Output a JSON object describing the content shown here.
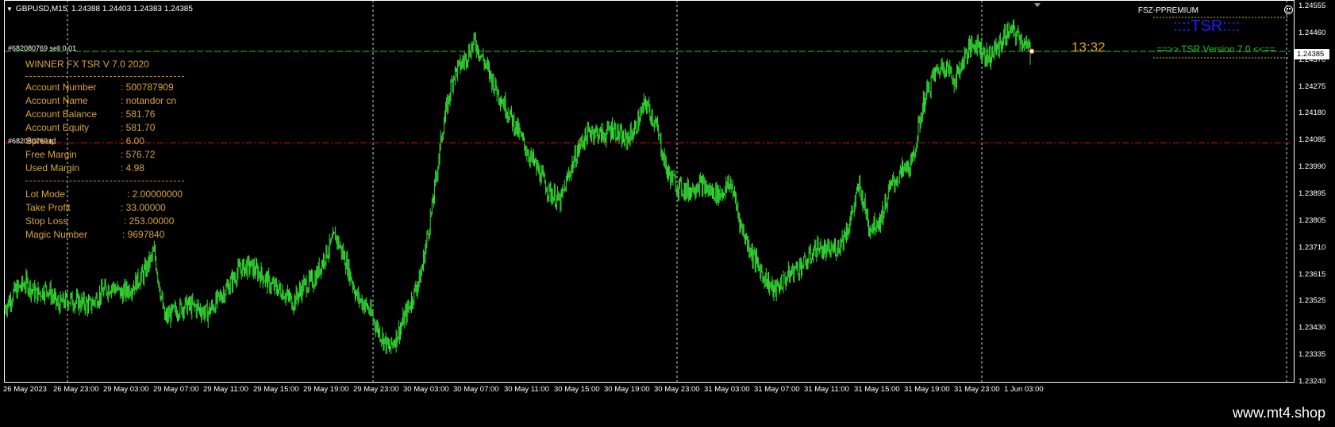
{
  "header": {
    "symbol": "GBPUSD,M15",
    "ohlc": "1.24388 1.24403 1.24383 1.24385"
  },
  "indicator_label": "FSZ-PPREMIUM",
  "tsr": {
    "title": "::::TSR::::",
    "version": "==>> TSR Version 7.0 <<=="
  },
  "countdown": "13:32",
  "orders": {
    "sell": "#682080769 sell 0.01",
    "tp": "#682080769 tp"
  },
  "panel": {
    "title": "WINNER FX TSR V 7.0  2020",
    "separator": "-------------------------------------------------",
    "account": [
      {
        "label": "Account Number",
        "value": ": 500787909"
      },
      {
        "label": "Account Name",
        "value": ": notandor cn"
      },
      {
        "label": "Account Balance",
        "value": ": 581.76"
      },
      {
        "label": "Account Equity",
        "value": ": 581.70"
      },
      {
        "label": "Spread",
        "value": ": 6.00"
      },
      {
        "label": "Free Margin",
        "value": ": 576.72"
      },
      {
        "label": "Used Margin",
        "value": ": 4.98"
      }
    ],
    "settings": [
      {
        "label": "Lot Mode",
        "value": ": 2.00000000"
      },
      {
        "label": "Take Profit",
        "value": ": 33.00000"
      },
      {
        "label": "Stop Loss",
        "value": ": 253.00000"
      },
      {
        "label": "Magic Number",
        "value": ": 9697840"
      }
    ]
  },
  "price_axis": {
    "ticks": [
      "1.24555",
      "1.24460",
      "1.24370",
      "1.24275",
      "1.24180",
      "1.24085",
      "1.23990",
      "1.23895",
      "1.23805",
      "1.23710",
      "1.23615",
      "1.23525",
      "1.23430",
      "1.23335",
      "1.23240"
    ],
    "current_price": "1.24385"
  },
  "time_axis": {
    "ticks": [
      "26 May 2023",
      "26 May 23:00",
      "29 May 03:00",
      "29 May 07:00",
      "29 May 11:00",
      "29 May 15:00",
      "29 May 19:00",
      "29 May 23:00",
      "30 May 03:00",
      "30 May 07:00",
      "30 May 11:00",
      "30 May 15:00",
      "30 May 19:00",
      "30 May 23:00",
      "31 May 03:00",
      "31 May 07:00",
      "31 May 11:00",
      "31 May 15:00",
      "31 May 19:00",
      "31 May 23:00",
      "1 Jun 03:00"
    ]
  },
  "chart_data": {
    "type": "candlestick",
    "symbol": "GBPUSD",
    "timeframe": "M15",
    "ylim": [
      1.2319,
      1.2457
    ],
    "order_sell_level": 1.24385,
    "order_tp_level": 1.24055,
    "close_path": [
      [
        0,
        1.2346
      ],
      [
        12,
        1.2352
      ],
      [
        25,
        1.2355
      ],
      [
        37,
        1.2351
      ],
      [
        50,
        1.2353
      ],
      [
        62,
        1.2347
      ],
      [
        75,
        1.2349
      ],
      [
        87,
        1.2348
      ],
      [
        100,
        1.2347
      ],
      [
        112,
        1.2351
      ],
      [
        125,
        1.2354
      ],
      [
        137,
        1.2351
      ],
      [
        150,
        1.2354
      ],
      [
        162,
        1.2358
      ],
      [
        175,
        1.2366
      ],
      [
        187,
        1.2342
      ],
      [
        200,
        1.2345
      ],
      [
        212,
        1.2347
      ],
      [
        225,
        1.2346
      ],
      [
        237,
        1.2344
      ],
      [
        250,
        1.2349
      ],
      [
        262,
        1.2354
      ],
      [
        275,
        1.236
      ],
      [
        287,
        1.2361
      ],
      [
        300,
        1.2358
      ],
      [
        312,
        1.2354
      ],
      [
        325,
        1.2352
      ],
      [
        337,
        1.2348
      ],
      [
        350,
        1.2354
      ],
      [
        362,
        1.2356
      ],
      [
        375,
        1.2365
      ],
      [
        387,
        1.2372
      ],
      [
        400,
        1.2362
      ],
      [
        412,
        1.235
      ],
      [
        425,
        1.2346
      ],
      [
        437,
        1.2338
      ],
      [
        450,
        1.2331
      ],
      [
        462,
        1.2338
      ],
      [
        475,
        1.2348
      ],
      [
        487,
        1.2358
      ],
      [
        500,
        1.2382
      ],
      [
        512,
        1.241
      ],
      [
        525,
        1.243
      ],
      [
        537,
        1.2435
      ],
      [
        550,
        1.2442
      ],
      [
        562,
        1.2434
      ],
      [
        575,
        1.2425
      ],
      [
        587,
        1.2418
      ],
      [
        600,
        1.241
      ],
      [
        612,
        1.2402
      ],
      [
        625,
        1.2395
      ],
      [
        637,
        1.2388
      ],
      [
        650,
        1.2384
      ],
      [
        662,
        1.2396
      ],
      [
        675,
        1.2406
      ],
      [
        687,
        1.241
      ],
      [
        700,
        1.2408
      ],
      [
        712,
        1.2411
      ],
      [
        725,
        1.2406
      ],
      [
        737,
        1.241
      ],
      [
        750,
        1.242
      ],
      [
        762,
        1.2412
      ],
      [
        775,
        1.2395
      ],
      [
        787,
        1.239
      ],
      [
        800,
        1.2388
      ],
      [
        812,
        1.2391
      ],
      [
        825,
        1.2388
      ],
      [
        837,
        1.2387
      ],
      [
        850,
        1.2391
      ],
      [
        862,
        1.2375
      ],
      [
        875,
        1.2365
      ],
      [
        887,
        1.2358
      ],
      [
        900,
        1.2352
      ],
      [
        912,
        1.2356
      ],
      [
        925,
        1.236
      ],
      [
        937,
        1.2362
      ],
      [
        950,
        1.2368
      ],
      [
        962,
        1.2366
      ],
      [
        975,
        1.2368
      ],
      [
        987,
        1.2375
      ],
      [
        1000,
        1.239
      ],
      [
        1012,
        1.2375
      ],
      [
        1025,
        1.2378
      ],
      [
        1037,
        1.239
      ],
      [
        1050,
        1.2395
      ],
      [
        1062,
        1.2398
      ],
      [
        1075,
        1.242
      ],
      [
        1087,
        1.243
      ],
      [
        1100,
        1.2434
      ],
      [
        1112,
        1.2428
      ],
      [
        1125,
        1.2438
      ],
      [
        1137,
        1.2442
      ],
      [
        1150,
        1.2436
      ],
      [
        1162,
        1.244
      ],
      [
        1175,
        1.2446
      ],
      [
        1187,
        1.2444
      ],
      [
        1200,
        1.2438
      ]
    ]
  }
}
